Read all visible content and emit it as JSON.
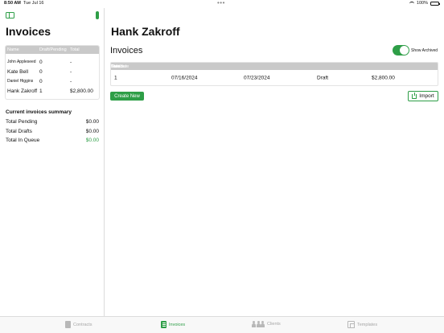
{
  "status_bar": {
    "time": "8:50 AM",
    "date": "Tue Jul 16",
    "battery": "100%",
    "dots": "•••"
  },
  "sidebar": {
    "title": "Invoices",
    "table": {
      "headers": {
        "name": "Name",
        "draft_pending": "Draft/Pending",
        "total": "Total"
      },
      "rows": [
        {
          "name": "John Appleseed",
          "draft_pending": "0",
          "total": "-"
        },
        {
          "name": "Kate Bell",
          "draft_pending": "0",
          "total": "-"
        },
        {
          "name": "Daniel Higgins",
          "draft_pending": "0",
          "total": "-"
        },
        {
          "name": "Hank Zakroff",
          "draft_pending": "1",
          "total": "$2,800.00"
        }
      ]
    },
    "summary": {
      "title": "Current invoices summary",
      "rows": [
        {
          "label": "Total Pending",
          "value": "$0.00"
        },
        {
          "label": "Total Drafts",
          "value": "$0.00"
        },
        {
          "label": "Total In Queue",
          "value": "$0.00"
        }
      ]
    }
  },
  "main": {
    "client_name": "Hank Zakroff",
    "section_title": "Invoices",
    "show_archived_label": "Show Archived",
    "show_archived": true,
    "table": {
      "headers": {
        "number": "Number",
        "date": "Date",
        "due_date": "Due date",
        "status": "Status",
        "total": "Total"
      },
      "rows": [
        {
          "number": "1",
          "date": "07/16/2024",
          "due_date": "07/23/2024",
          "status": "Draft",
          "total": "$2,800.00"
        }
      ]
    },
    "create_new_label": "Create New",
    "import_label": "Import"
  },
  "tab_bar": {
    "tabs": [
      {
        "label": "Contracts",
        "icon": "document-icon",
        "active": false
      },
      {
        "label": "Invoices",
        "icon": "invoice-icon",
        "active": true
      },
      {
        "label": "Clients",
        "icon": "people-icon",
        "active": false
      },
      {
        "label": "Templates",
        "icon": "template-icon",
        "active": false
      }
    ]
  },
  "colors": {
    "accent": "#2e9e47",
    "header_gray": "#c9c9c9"
  }
}
